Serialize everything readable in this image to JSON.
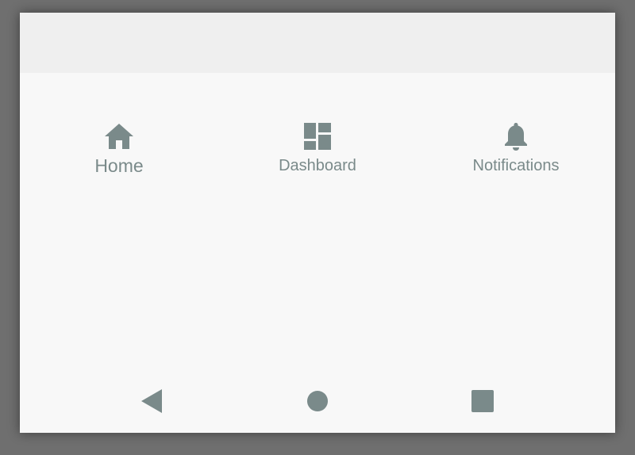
{
  "colors": {
    "icon": "#7a8a8a",
    "label": "#7a8a8a",
    "background": "#f8f8f8",
    "app_bar": "#efefef"
  },
  "bottom_nav": {
    "active": "home",
    "items": [
      {
        "id": "home",
        "label": "Home",
        "icon": "home-icon"
      },
      {
        "id": "dashboard",
        "label": "Dashboard",
        "icon": "dashboard-icon"
      },
      {
        "id": "notifications",
        "label": "Notifications",
        "icon": "bell-icon"
      }
    ]
  },
  "system_nav": {
    "buttons": [
      {
        "id": "back",
        "icon": "back-triangle-icon"
      },
      {
        "id": "home",
        "icon": "home-circle-icon"
      },
      {
        "id": "recents",
        "icon": "recents-square-icon"
      }
    ]
  }
}
